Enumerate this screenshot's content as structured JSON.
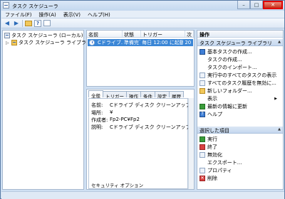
{
  "window": {
    "title": "タスク スケジューラ"
  },
  "menu": [
    "ファイル(F)",
    "操作(A)",
    "表示(V)",
    "ヘルプ(H)"
  ],
  "tree": {
    "root": "タスク スケジューラ (ローカル)",
    "child": "タスク スケジューラ ライブラリ"
  },
  "task_list": {
    "columns": [
      "名前",
      "状態",
      "トリガー",
      "次"
    ],
    "rows": [
      {
        "name": "Cドライブ...",
        "status": "準備完了",
        "trigger": "毎日 12:00 に起動",
        "next": "20"
      }
    ]
  },
  "details": {
    "tabs": [
      "全般",
      "トリガー",
      "操作",
      "条件",
      "設定",
      "履歴"
    ],
    "fields": [
      {
        "label": "名前:",
        "value": "Cドライブ ディスク クリーンアップ"
      },
      {
        "label": "場所:",
        "value": "¥"
      },
      {
        "label": "作成者:",
        "value": "Fp2-PC¥Fp2"
      },
      {
        "label": "説明:",
        "value": "Cドライブ ディスク クリーンアップ"
      }
    ],
    "security_label": "セキュリティ オプション"
  },
  "actions": {
    "title": "操作",
    "section1": {
      "header": "タスク スケジューラ ライブラリ",
      "items": [
        {
          "icon": "create-basic-task-icon",
          "label": "基本タスクの作成..."
        },
        {
          "icon": "blank",
          "label": "タスクの作成..."
        },
        {
          "icon": "blank",
          "label": "タスクのインポート..."
        },
        {
          "icon": "running-tasks-icon",
          "label": "実行中のすべてのタスクの表示"
        },
        {
          "icon": "history-icon",
          "label": "すべてのタスク履歴を無効に..."
        },
        {
          "icon": "new-folder-icon",
          "label": "新しいフォルダー..."
        },
        {
          "icon": "blank",
          "label": "表示"
        },
        {
          "icon": "refresh-icon",
          "label": "最新の情報に更新"
        },
        {
          "icon": "help-icon",
          "label": "ヘルプ"
        }
      ]
    },
    "section2": {
      "header": "選択した項目",
      "items": [
        {
          "icon": "run-icon",
          "label": "実行"
        },
        {
          "icon": "end-icon",
          "label": "終了"
        },
        {
          "icon": "disable-icon",
          "label": "無効化"
        },
        {
          "icon": "blank",
          "label": "エクスポート..."
        },
        {
          "icon": "properties-icon",
          "label": "プロパティ"
        },
        {
          "icon": "delete-icon",
          "label": "削除"
        }
      ]
    }
  }
}
